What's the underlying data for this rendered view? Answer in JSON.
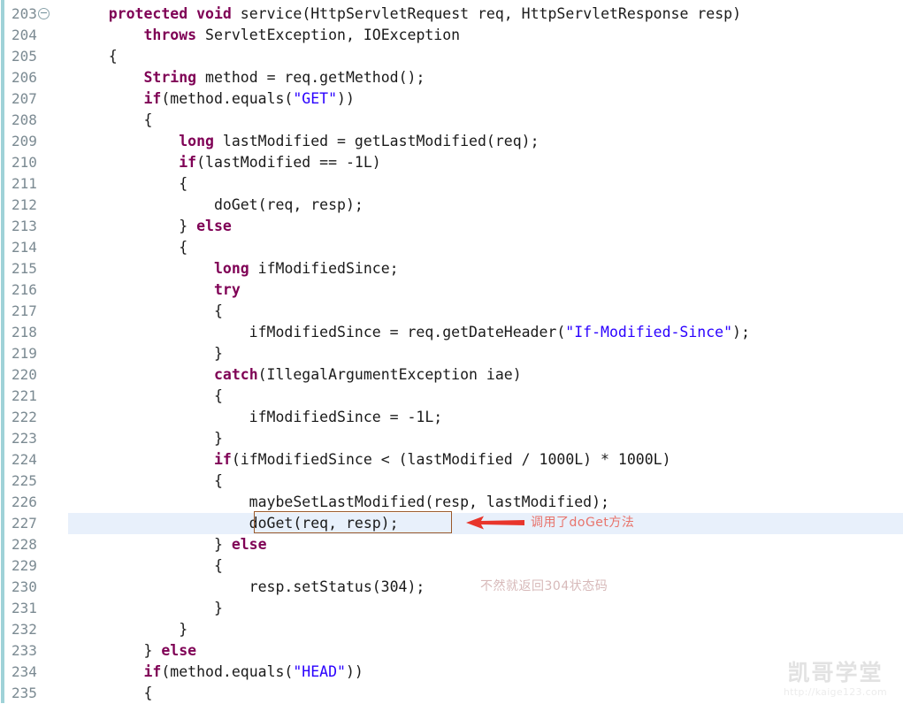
{
  "editor": {
    "language": "java",
    "first_line_number": 203,
    "highlighted_line": 227,
    "fold_marker_line": 203,
    "fold_marker_glyph": "minus-circle",
    "colors": {
      "background": "#ffffff",
      "gutter_text": "#7b8a92",
      "annotation_ruler": "#9fd2d8",
      "keyword": "#7f0055",
      "string": "#2a00ff",
      "plain": "#1a1a1a",
      "current_line_highlight": "#e8f0fb",
      "callout_box_border": "#9b5a2b",
      "callout_arrow": "#e8352b",
      "callout_text": "#e8736b",
      "note_text": "#d7b9b9",
      "watermark": "#e2e2e2"
    },
    "lines": [
      {
        "n": "203",
        "fold": true,
        "tokens": [
          {
            "t": "    ",
            "c": "pln"
          },
          {
            "t": "protected",
            "c": "kw"
          },
          {
            "t": " ",
            "c": "pln"
          },
          {
            "t": "void",
            "c": "kw"
          },
          {
            "t": " service(HttpServletRequest req, HttpServletResponse resp)",
            "c": "pln"
          }
        ]
      },
      {
        "n": "204",
        "fold": false,
        "tokens": [
          {
            "t": "        ",
            "c": "pln"
          },
          {
            "t": "throws",
            "c": "kw"
          },
          {
            "t": " ServletException, IOException",
            "c": "pln"
          }
        ]
      },
      {
        "n": "205",
        "fold": false,
        "tokens": [
          {
            "t": "    {",
            "c": "pln"
          }
        ]
      },
      {
        "n": "206",
        "fold": false,
        "tokens": [
          {
            "t": "        ",
            "c": "pln"
          },
          {
            "t": "String",
            "c": "kw"
          },
          {
            "t": " method = req.getMethod();",
            "c": "pln"
          }
        ]
      },
      {
        "n": "207",
        "fold": false,
        "tokens": [
          {
            "t": "        ",
            "c": "pln"
          },
          {
            "t": "if",
            "c": "kw"
          },
          {
            "t": "(method.equals(",
            "c": "pln"
          },
          {
            "t": "\"GET\"",
            "c": "str"
          },
          {
            "t": "))",
            "c": "pln"
          }
        ]
      },
      {
        "n": "208",
        "fold": false,
        "tokens": [
          {
            "t": "        {",
            "c": "pln"
          }
        ]
      },
      {
        "n": "209",
        "fold": false,
        "tokens": [
          {
            "t": "            ",
            "c": "pln"
          },
          {
            "t": "long",
            "c": "kw"
          },
          {
            "t": " lastModified = getLastModified(req);",
            "c": "pln"
          }
        ]
      },
      {
        "n": "210",
        "fold": false,
        "tokens": [
          {
            "t": "            ",
            "c": "pln"
          },
          {
            "t": "if",
            "c": "kw"
          },
          {
            "t": "(lastModified == -1L)",
            "c": "pln"
          }
        ]
      },
      {
        "n": "211",
        "fold": false,
        "tokens": [
          {
            "t": "            {",
            "c": "pln"
          }
        ]
      },
      {
        "n": "212",
        "fold": false,
        "tokens": [
          {
            "t": "                doGet(req, resp);",
            "c": "pln"
          }
        ]
      },
      {
        "n": "213",
        "fold": false,
        "tokens": [
          {
            "t": "            } ",
            "c": "pln"
          },
          {
            "t": "else",
            "c": "kw"
          }
        ]
      },
      {
        "n": "214",
        "fold": false,
        "tokens": [
          {
            "t": "            {",
            "c": "pln"
          }
        ]
      },
      {
        "n": "215",
        "fold": false,
        "tokens": [
          {
            "t": "                ",
            "c": "pln"
          },
          {
            "t": "long",
            "c": "kw"
          },
          {
            "t": " ifModifiedSince;",
            "c": "pln"
          }
        ]
      },
      {
        "n": "216",
        "fold": false,
        "tokens": [
          {
            "t": "                ",
            "c": "pln"
          },
          {
            "t": "try",
            "c": "kw"
          }
        ]
      },
      {
        "n": "217",
        "fold": false,
        "tokens": [
          {
            "t": "                {",
            "c": "pln"
          }
        ]
      },
      {
        "n": "218",
        "fold": false,
        "tokens": [
          {
            "t": "                    ifModifiedSince = req.getDateHeader(",
            "c": "pln"
          },
          {
            "t": "\"If-Modified-Since\"",
            "c": "str"
          },
          {
            "t": ");",
            "c": "pln"
          }
        ]
      },
      {
        "n": "219",
        "fold": false,
        "tokens": [
          {
            "t": "                }",
            "c": "pln"
          }
        ]
      },
      {
        "n": "220",
        "fold": false,
        "tokens": [
          {
            "t": "                ",
            "c": "pln"
          },
          {
            "t": "catch",
            "c": "kw"
          },
          {
            "t": "(IllegalArgumentException iae)",
            "c": "pln"
          }
        ]
      },
      {
        "n": "221",
        "fold": false,
        "tokens": [
          {
            "t": "                {",
            "c": "pln"
          }
        ]
      },
      {
        "n": "222",
        "fold": false,
        "tokens": [
          {
            "t": "                    ifModifiedSince = -1L;",
            "c": "pln"
          }
        ]
      },
      {
        "n": "223",
        "fold": false,
        "tokens": [
          {
            "t": "                }",
            "c": "pln"
          }
        ]
      },
      {
        "n": "224",
        "fold": false,
        "tokens": [
          {
            "t": "                ",
            "c": "pln"
          },
          {
            "t": "if",
            "c": "kw"
          },
          {
            "t": "(ifModifiedSince < (lastModified / 1000L) * 1000L)",
            "c": "pln"
          }
        ]
      },
      {
        "n": "225",
        "fold": false,
        "tokens": [
          {
            "t": "                {",
            "c": "pln"
          }
        ]
      },
      {
        "n": "226",
        "fold": false,
        "tokens": [
          {
            "t": "                    maybeSetLastModified(resp, lastModified);",
            "c": "pln"
          }
        ]
      },
      {
        "n": "227",
        "fold": false,
        "highlight": true,
        "tokens": [
          {
            "t": "                    doGet(req, resp);",
            "c": "pln"
          }
        ]
      },
      {
        "n": "228",
        "fold": false,
        "tokens": [
          {
            "t": "                } ",
            "c": "pln"
          },
          {
            "t": "else",
            "c": "kw"
          }
        ]
      },
      {
        "n": "229",
        "fold": false,
        "tokens": [
          {
            "t": "                {",
            "c": "pln"
          }
        ]
      },
      {
        "n": "230",
        "fold": false,
        "tokens": [
          {
            "t": "                    resp.setStatus(304);",
            "c": "pln"
          }
        ]
      },
      {
        "n": "231",
        "fold": false,
        "tokens": [
          {
            "t": "                }",
            "c": "pln"
          }
        ]
      },
      {
        "n": "232",
        "fold": false,
        "tokens": [
          {
            "t": "            }",
            "c": "pln"
          }
        ]
      },
      {
        "n": "233",
        "fold": false,
        "tokens": [
          {
            "t": "        } ",
            "c": "pln"
          },
          {
            "t": "else",
            "c": "kw"
          }
        ]
      },
      {
        "n": "234",
        "fold": false,
        "tokens": [
          {
            "t": "        ",
            "c": "pln"
          },
          {
            "t": "if",
            "c": "kw"
          },
          {
            "t": "(method.equals(",
            "c": "pln"
          },
          {
            "t": "\"HEAD\"",
            "c": "str"
          },
          {
            "t": "))",
            "c": "pln"
          }
        ]
      },
      {
        "n": "235",
        "fold": false,
        "tokens": [
          {
            "t": "        {",
            "c": "pln"
          }
        ]
      }
    ]
  },
  "annotations": {
    "callout": {
      "text": "调用了doGet方法",
      "arrow_direction": "left",
      "target_line": "227",
      "target_code": "doGet(req, resp);"
    },
    "note": {
      "text": "不然就返回304状态码",
      "target_line": "230",
      "target_code": "resp.setStatus(304);"
    }
  },
  "watermark": {
    "logo": "凯哥学堂",
    "url": "http://kaige123.com"
  }
}
